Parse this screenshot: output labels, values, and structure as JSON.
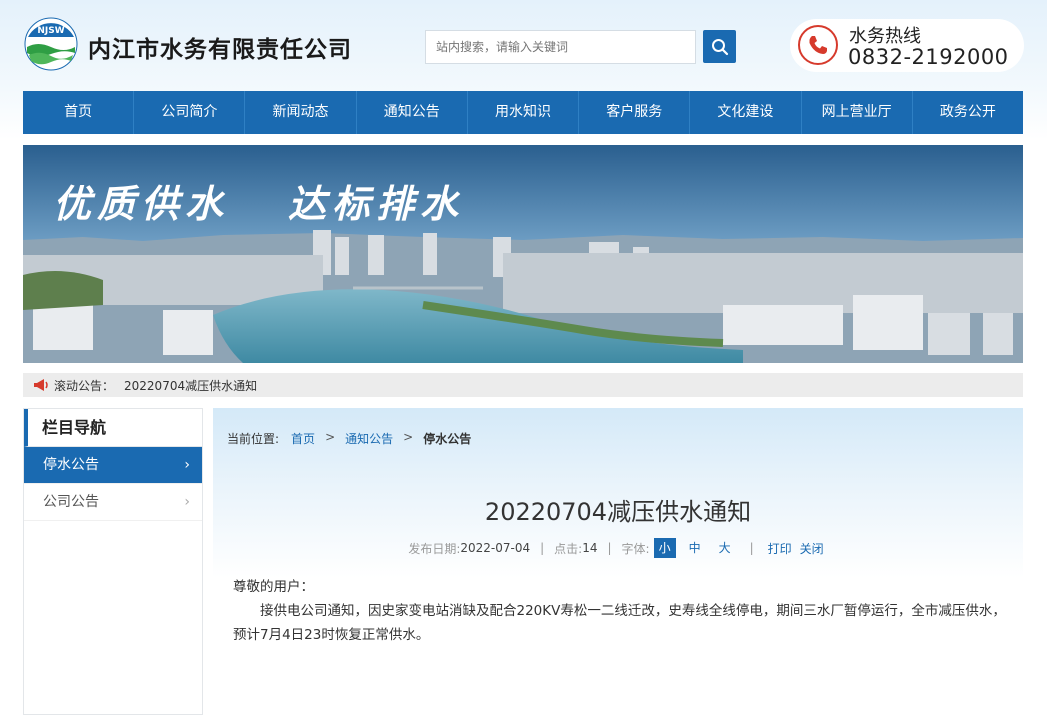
{
  "brand": {
    "logo_text": "NJSW",
    "company_name": "内江市水务有限责任公司"
  },
  "search": {
    "placeholder": "站内搜索，请输入关键词"
  },
  "hotline": {
    "label": "水务热线",
    "number": "0832-2192000"
  },
  "nav": {
    "items": [
      "首页",
      "公司简介",
      "新闻动态",
      "通知公告",
      "用水知识",
      "客户服务",
      "文化建设",
      "网上营业厅",
      "政务公开"
    ]
  },
  "banner": {
    "slogan_left": "优质供水",
    "slogan_right": "达标排水"
  },
  "ticker": {
    "label": "滚动公告：",
    "text": "20220704减压供水通知"
  },
  "sidebar": {
    "title": "栏目导航",
    "items": [
      {
        "label": "停水公告",
        "active": true
      },
      {
        "label": "公司公告",
        "active": false
      }
    ]
  },
  "breadcrumb": {
    "prefix": "当前位置:",
    "items": [
      "首页",
      "通知公告",
      "停水公告"
    ]
  },
  "article": {
    "title": "20220704减压供水通知",
    "date_label": "发布日期:",
    "date": "2022-07-04",
    "hits_label": "点击:",
    "hits": "14",
    "font_label": "字体:",
    "font_sizes": [
      "小",
      "中",
      "大"
    ],
    "print_label": "打印",
    "close_label": "关闭",
    "greeting": "尊敬的用户：",
    "body": "接供电公司通知，因史家变电站消缺及配合220KV寿松一二线迁改，史寿线全线停电，期间三水厂暂停运行，全市减压供水，预计7月4日23时恢复正常供水。"
  },
  "colors": {
    "primary": "#1a6ab1",
    "hotline_red": "#d63a2c"
  }
}
